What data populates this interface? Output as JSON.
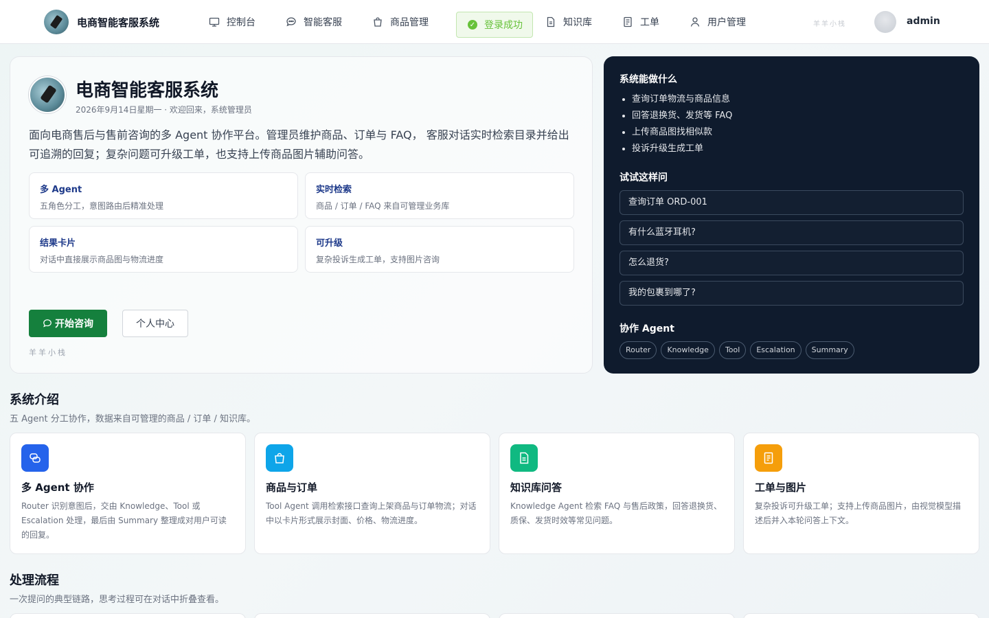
{
  "nav": {
    "brand": "电商智能客服系统",
    "items": [
      {
        "label": "控制台",
        "icon": "monitor-icon"
      },
      {
        "label": "智能客服",
        "icon": "chat-icon"
      },
      {
        "label": "商品管理",
        "icon": "shopping-bag-icon"
      },
      {
        "label": "知识库",
        "icon": "document-icon"
      },
      {
        "label": "工单",
        "icon": "ticket-icon"
      },
      {
        "label": "用户管理",
        "icon": "user-icon"
      }
    ],
    "toast": "登录成功",
    "watermark_small": "羊羊小栈",
    "username": "admin"
  },
  "hero": {
    "title": "电商智能客服系统",
    "subtitle": "2026年9月14日星期一 · 欢迎回来，系统管理员",
    "description": "面向电商售后与售前咨询的多 Agent 协作平台。管理员维护商品、订单与 FAQ， 客服对话实时检索目录并给出可追溯的回复；复杂问题可升级工单，也支持上传商品图片辅助问答。",
    "features": [
      {
        "title": "多 Agent",
        "desc": "五角色分工，意图路由后精准处理"
      },
      {
        "title": "实时检索",
        "desc": "商品 / 订单 / FAQ 来自可管理业务库"
      },
      {
        "title": "结果卡片",
        "desc": "对话中直接展示商品图与物流进度"
      },
      {
        "title": "可升级",
        "desc": "复杂投诉生成工单，支持图片咨询"
      }
    ],
    "primary_button": "开始咨询",
    "secondary_button": "个人中心",
    "watermark": "羊羊小栈"
  },
  "panel": {
    "capabilities_title": "系统能做什么",
    "capabilities": [
      "查询订单物流与商品信息",
      "回答退换货、发货等 FAQ",
      "上传商品图找相似款",
      "投诉升级生成工单"
    ],
    "try_title": "试试这样问",
    "questions": [
      "查询订单 ORD-001",
      "有什么蓝牙耳机?",
      "怎么退货?",
      "我的包裹到哪了?"
    ],
    "agents_title": "协作 Agent",
    "agents": [
      "Router",
      "Knowledge",
      "Tool",
      "Escalation",
      "Summary"
    ]
  },
  "intro": {
    "title": "系统介绍",
    "subtitle": "五 Agent 分工协作，数据来自可管理的商品 / 订单 / 知识库。",
    "cards": [
      {
        "title": "多 Agent 协作",
        "desc": "Router 识别意图后，交由 Knowledge、Tool 或 Escalation 处理，最后由 Summary 整理成对用户可读的回复。",
        "icon": "chat-bubbles-icon",
        "color": "#2563eb"
      },
      {
        "title": "商品与订单",
        "desc": "Tool Agent 调用检索接口查询上架商品与订单物流；对话中以卡片形式展示封面、价格、物流进度。",
        "icon": "shopping-bag-icon",
        "color": "#0ea5e9"
      },
      {
        "title": "知识库问答",
        "desc": "Knowledge Agent 检索 FAQ 与售后政策，回答退换货、质保、发货时效等常见问题。",
        "icon": "document-icon",
        "color": "#10b981"
      },
      {
        "title": "工单与图片",
        "desc": "复杂投诉可升级工单；支持上传商品图片，由视觉模型描述后并入本轮问答上下文。",
        "icon": "ticket-icon",
        "color": "#f59e0b"
      }
    ]
  },
  "flow": {
    "title": "处理流程",
    "subtitle": "一次提问的典型链路，思考过程可在对话中折叠查看。"
  }
}
